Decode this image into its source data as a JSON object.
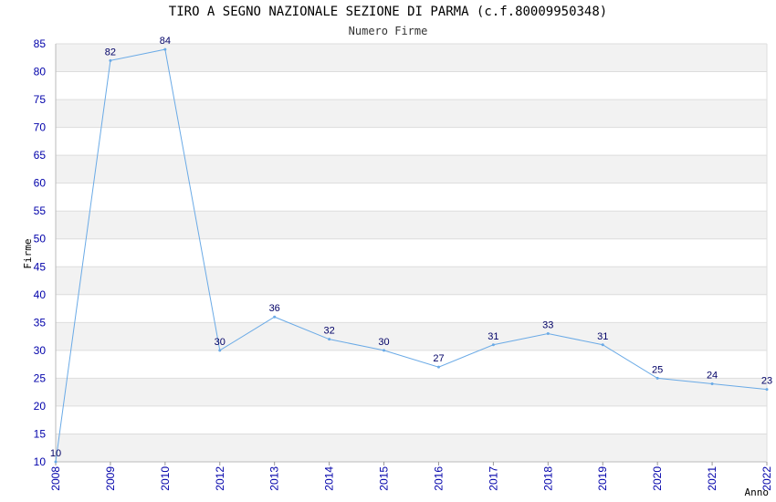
{
  "chart_data": {
    "type": "line",
    "title": "TIRO A SEGNO NAZIONALE SEZIONE DI PARMA (c.f.80009950348)",
    "subtitle": "Numero Firme",
    "xlabel": "Anno",
    "ylabel": "Firme",
    "categories": [
      "2008",
      "2009",
      "2010",
      "2012",
      "2013",
      "2014",
      "2015",
      "2016",
      "2017",
      "2018",
      "2019",
      "2020",
      "2021",
      "2022"
    ],
    "values": [
      10,
      82,
      84,
      30,
      36,
      32,
      30,
      27,
      31,
      33,
      31,
      25,
      24,
      23
    ],
    "ylim": [
      10,
      85
    ],
    "yticks": [
      10,
      15,
      20,
      25,
      30,
      35,
      40,
      45,
      50,
      55,
      60,
      65,
      70,
      75,
      80,
      85
    ],
    "grid": true,
    "colors": {
      "line": "#6aaae6",
      "band": "#f2f2f2",
      "grid": "#dddddd",
      "tick_text": "#0000aa",
      "label_text": "#000066"
    }
  }
}
